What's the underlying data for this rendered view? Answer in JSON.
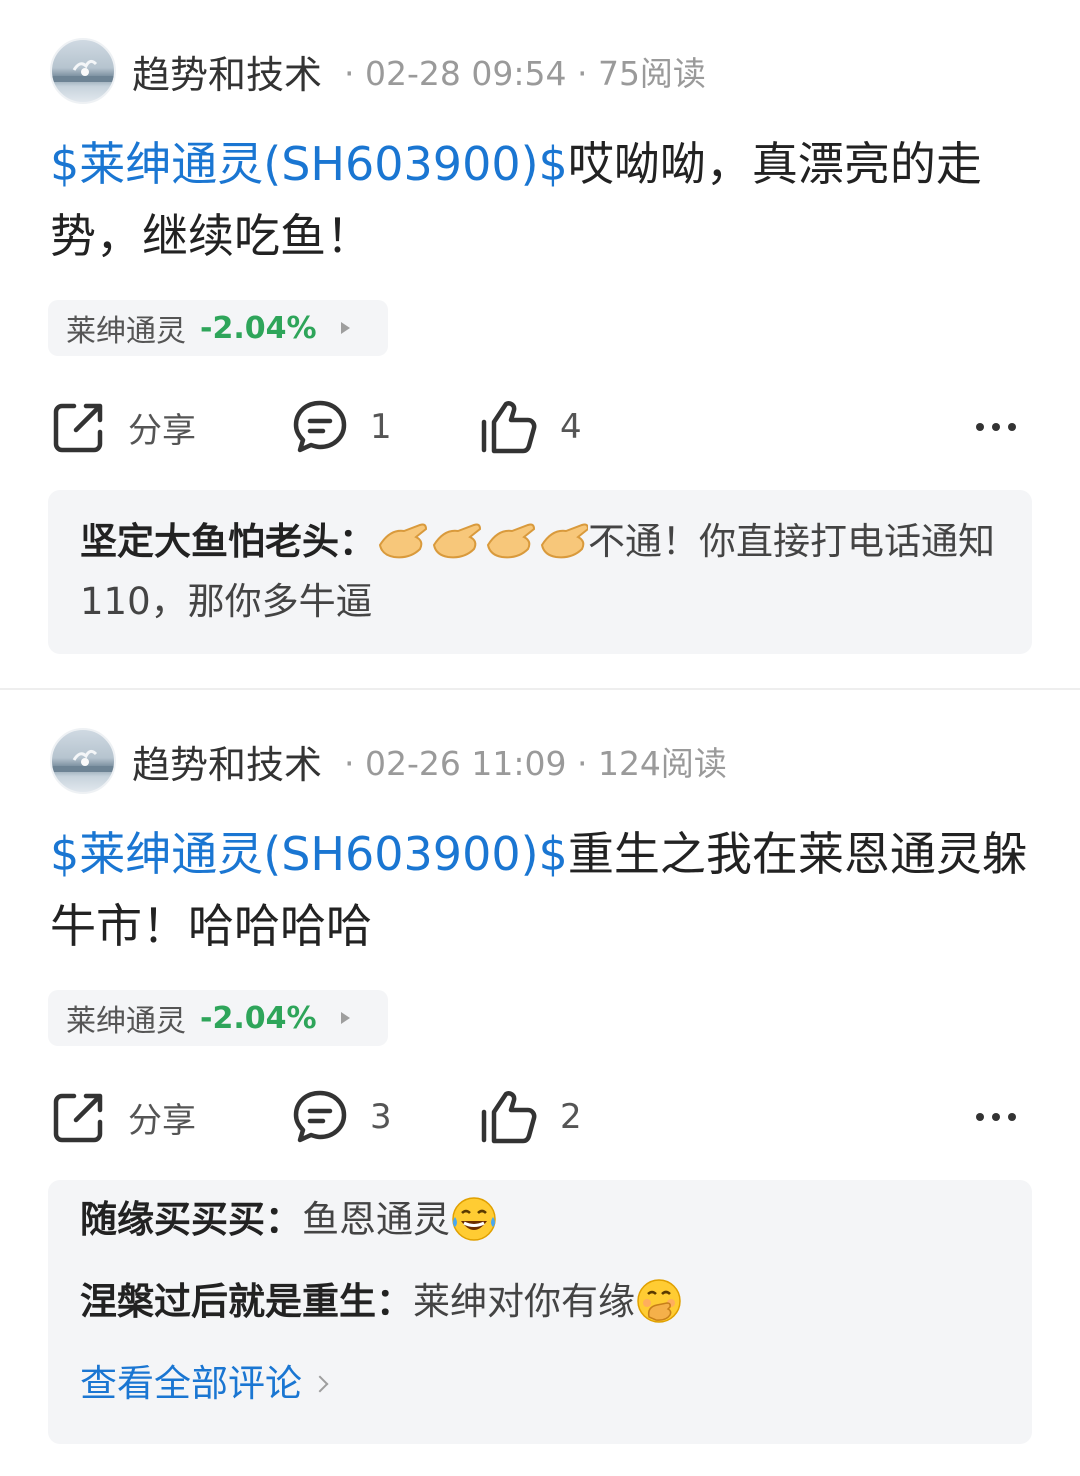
{
  "posts": [
    {
      "author": "趋势和技术",
      "meta": "· 02-28 09:54 · 75阅读",
      "stock_link": "$莱绅通灵(SH603900)$",
      "text": "哎呦呦，真漂亮的走势，继续吃鱼！",
      "tag": {
        "name": "莱绅通灵",
        "change": "-2.04%"
      },
      "actions": {
        "share": "分享",
        "comments": "1",
        "likes": "4"
      },
      "comments": [
        {
          "user": "坚定大鱼怕老头：",
          "text": "不通！你直接打电话通知110，那你多牛逼",
          "emoji": "clap-hands-emoji"
        }
      ]
    },
    {
      "author": "趋势和技术",
      "meta": "· 02-26 11:09 · 124阅读",
      "stock_link": "$莱绅通灵(SH603900)$",
      "text": "重生之我在莱恩通灵躲牛市！哈哈哈哈",
      "tag": {
        "name": "莱绅通灵",
        "change": "-2.04%"
      },
      "actions": {
        "share": "分享",
        "comments": "3",
        "likes": "2"
      },
      "comments": [
        {
          "user": "随缘买买买：",
          "text": "鱼恩通灵",
          "emoji": "tears-of-joy-emoji"
        },
        {
          "user": "涅槃过后就是重生：",
          "text": "莱绅对你有缘",
          "emoji": "hand-over-mouth-emoji"
        }
      ],
      "view_all": "查看全部评论"
    }
  ],
  "colors": {
    "link": "#1a76d2",
    "down": "#2ea55a",
    "bg_card": "#f4f5f7"
  }
}
